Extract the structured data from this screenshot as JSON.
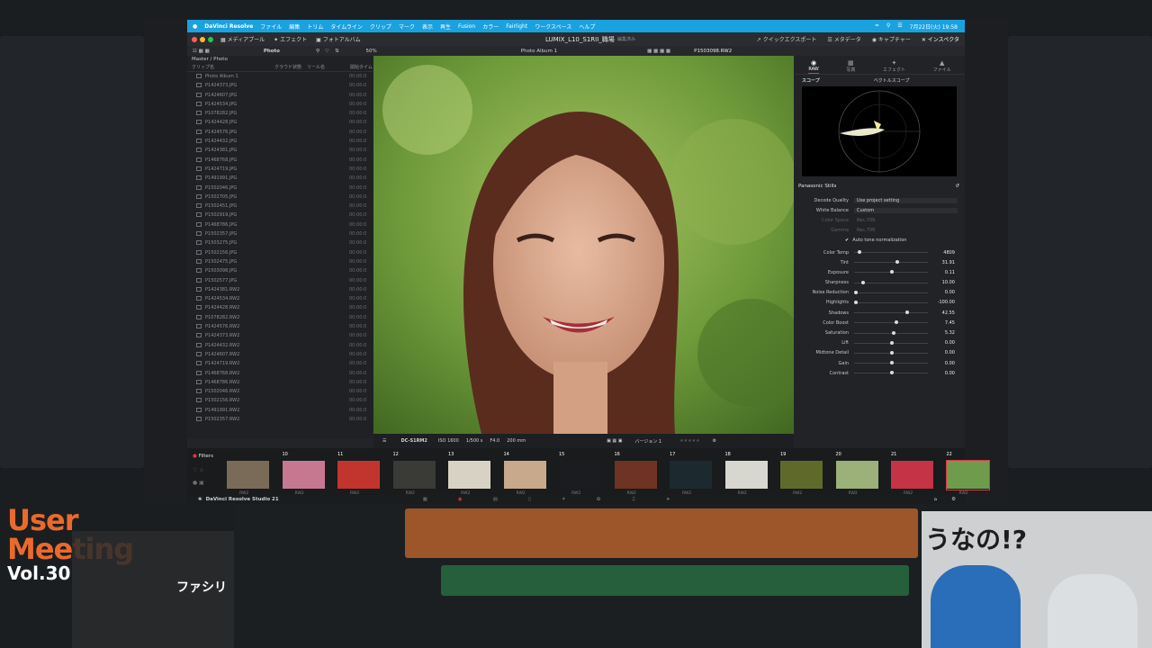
{
  "menubar": {
    "apple": "",
    "items": [
      "DaVinci Resolve",
      "ファイル",
      "編集",
      "トリム",
      "タイムライン",
      "クリップ",
      "マーク",
      "表示",
      "再生",
      "Fusion",
      "カラー",
      "Fairlight",
      "ワークスペース",
      "ヘルプ"
    ],
    "clock": "7月22日(火) 19:58"
  },
  "toolbar": {
    "media_pool": "メディアプール",
    "effects": "エフェクト",
    "photo_album": "フォトアルバム",
    "project_title": "LUMIX_L10_S1RII_職場",
    "edit_status": "編集済み",
    "quick_export": "クイックエクスポート",
    "metadata": "メタデータ",
    "capture": "キャプチャー",
    "inspector": "インスペクタ"
  },
  "subbar": {
    "photo_label": "Photo",
    "zoom": "50%",
    "album": "Photo Album 1",
    "filename": "P1503098.RW2"
  },
  "media_pool": {
    "breadcrumb": "Master / Photo",
    "columns": [
      "クリップ名",
      "クラウド状態",
      "リール名",
      "開始タイム"
    ],
    "items": [
      {
        "name": "Photo Album 1",
        "dur": "00:00:0"
      },
      {
        "name": "P1424373.JPG",
        "dur": "00:00:0"
      },
      {
        "name": "P1424607.JPG",
        "dur": "00:00:0"
      },
      {
        "name": "P1424534.JPG",
        "dur": "00:00:0"
      },
      {
        "name": "P1078282.JPG",
        "dur": "00:00:0"
      },
      {
        "name": "P1424428.JPG",
        "dur": "00:00:0"
      },
      {
        "name": "P1424576.JPG",
        "dur": "00:00:0"
      },
      {
        "name": "P1424432.JPG",
        "dur": "00:00:0"
      },
      {
        "name": "P1424381.JPG",
        "dur": "00:00:0"
      },
      {
        "name": "P1468768.JPG",
        "dur": "00:00:0"
      },
      {
        "name": "P1424719.JPG",
        "dur": "00:00:0"
      },
      {
        "name": "P1491991.JPG",
        "dur": "00:00:0"
      },
      {
        "name": "P1502046.JPG",
        "dur": "00:00:0"
      },
      {
        "name": "P1502705.JPG",
        "dur": "00:00:0"
      },
      {
        "name": "P1502451.JPG",
        "dur": "00:00:0"
      },
      {
        "name": "P1502919.JPG",
        "dur": "00:00:0"
      },
      {
        "name": "P1468786.JPG",
        "dur": "00:00:0"
      },
      {
        "name": "P1502357.JPG",
        "dur": "00:00:0"
      },
      {
        "name": "P1503275.JPG",
        "dur": "00:00:0"
      },
      {
        "name": "P1502156.JPG",
        "dur": "00:00:0"
      },
      {
        "name": "P1502475.JPG",
        "dur": "00:00:0"
      },
      {
        "name": "P1503098.JPG",
        "dur": "00:00:0"
      },
      {
        "name": "P1502577.JPG",
        "dur": "00:00:0"
      },
      {
        "name": "P1424381.RW2",
        "dur": "00:00:0"
      },
      {
        "name": "P1424534.RW2",
        "dur": "00:00:0"
      },
      {
        "name": "P1424428.RW2",
        "dur": "00:00:0"
      },
      {
        "name": "P1078282.RW2",
        "dur": "00:00:0"
      },
      {
        "name": "P1424576.RW2",
        "dur": "00:00:0"
      },
      {
        "name": "P1424373.RW2",
        "dur": "00:00:0"
      },
      {
        "name": "P1424432.RW2",
        "dur": "00:00:0"
      },
      {
        "name": "P1424607.RW2",
        "dur": "00:00:0"
      },
      {
        "name": "P1424719.RW2",
        "dur": "00:00:0"
      },
      {
        "name": "P1468768.RW2",
        "dur": "00:00:0"
      },
      {
        "name": "P1468786.RW2",
        "dur": "00:00:0"
      },
      {
        "name": "P1502046.RW2",
        "dur": "00:00:0"
      },
      {
        "name": "P1502156.RW2",
        "dur": "00:00:0"
      },
      {
        "name": "P1491991.RW2",
        "dur": "00:00:0"
      },
      {
        "name": "P1502357.RW2",
        "dur": "00:00:0"
      }
    ]
  },
  "viewer_bar": {
    "camera": "DC-S1RM2",
    "iso": "ISO 1600",
    "shutter": "1/500 s",
    "aperture": "F4.0",
    "focal": "200 mm",
    "version": "バージョン 1"
  },
  "inspector": {
    "tabs": [
      "RAW",
      "写真",
      "エフェクト",
      "ファイル"
    ],
    "scope_label": "スコープ",
    "scope_type": "ベクトルスコープ",
    "section": "Panasonic Stills",
    "decode_quality_label": "Decode Quality",
    "decode_quality": "Use project setting",
    "white_balance_label": "White Balance",
    "white_balance": "Custom",
    "color_space_label": "Color Space",
    "color_space": "Rec.709",
    "gamma_label": "Gamma",
    "gamma": "Rec.709",
    "auto_tone": "Auto tone normalization",
    "params": [
      {
        "label": "Color Temp",
        "value": "4809",
        "pos": 0.05
      },
      {
        "label": "Tint",
        "value": "31.91",
        "pos": 0.58
      },
      {
        "label": "Exposure",
        "value": "0.11",
        "pos": 0.5
      },
      {
        "label": "Sharpness",
        "value": "10.00",
        "pos": 0.1
      },
      {
        "label": "Noise Reduction",
        "value": "0.00",
        "pos": 0.0
      },
      {
        "label": "Highlights",
        "value": "-100.00",
        "pos": 0.0
      },
      {
        "label": "Shadows",
        "value": "42.55",
        "pos": 0.71
      },
      {
        "label": "Color Boost",
        "value": "7.45",
        "pos": 0.56
      },
      {
        "label": "Saturation",
        "value": "5.32",
        "pos": 0.53
      },
      {
        "label": "Lift",
        "value": "0.00",
        "pos": 0.5
      },
      {
        "label": "Midtone Detail",
        "value": "0.00",
        "pos": 0.5
      },
      {
        "label": "Gain",
        "value": "0.00",
        "pos": 0.5
      },
      {
        "label": "Contrast",
        "value": "0.00",
        "pos": 0.5
      }
    ]
  },
  "filmstrip": {
    "filters": "Filters",
    "clips": [
      {
        "num": "",
        "type": "RW2",
        "color": "#7a6a58"
      },
      {
        "num": "10",
        "type": "RW2",
        "color": "#c77891"
      },
      {
        "num": "11",
        "type": "RW2",
        "color": "#c2342e"
      },
      {
        "num": "12",
        "type": "RW2",
        "color": "#3a3a36"
      },
      {
        "num": "13",
        "type": "RW2",
        "color": "#d8d2c4"
      },
      {
        "num": "14",
        "type": "RW2",
        "color": "#c8a98c"
      },
      {
        "num": "15",
        "type": "RW2",
        "color": "#1a1c20"
      },
      {
        "num": "16",
        "type": "RW2",
        "color": "#6e3322"
      },
      {
        "num": "17",
        "type": "RW2",
        "color": "#1c2a30"
      },
      {
        "num": "18",
        "type": "RW2",
        "color": "#d7d6cf"
      },
      {
        "num": "19",
        "type": "RW2",
        "color": "#5f6a2a"
      },
      {
        "num": "20",
        "type": "RW2",
        "color": "#9cb07a"
      },
      {
        "num": "21",
        "type": "RW2",
        "color": "#c43346"
      },
      {
        "num": "22",
        "type": "RW2",
        "color": "#6e9c4c"
      }
    ]
  },
  "footer": {
    "app_name": "DaVinci Resolve Studio 21"
  },
  "overlay": {
    "logo_line1": "User",
    "logo_line2": "Meeting",
    "logo_line3": "Vol.30",
    "caption": "ファシリ",
    "webcam_text": "うなの!?"
  },
  "colors": {
    "menubar": "#1aa1e0",
    "accent_red": "#e0354a",
    "logo_orange": "#ea6a2c"
  }
}
